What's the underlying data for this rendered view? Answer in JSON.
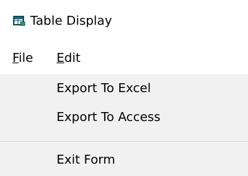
{
  "window": {
    "title": "Table Display",
    "icon": "table-window-icon"
  },
  "menubar": {
    "items": [
      {
        "label": "File",
        "mnemonic": "F"
      },
      {
        "label": "Edit",
        "mnemonic": "E"
      }
    ]
  },
  "dropdown": {
    "items": [
      {
        "label": "Export To Excel"
      },
      {
        "label": "Export To Access"
      },
      {
        "label": "Exit Form"
      }
    ]
  }
}
